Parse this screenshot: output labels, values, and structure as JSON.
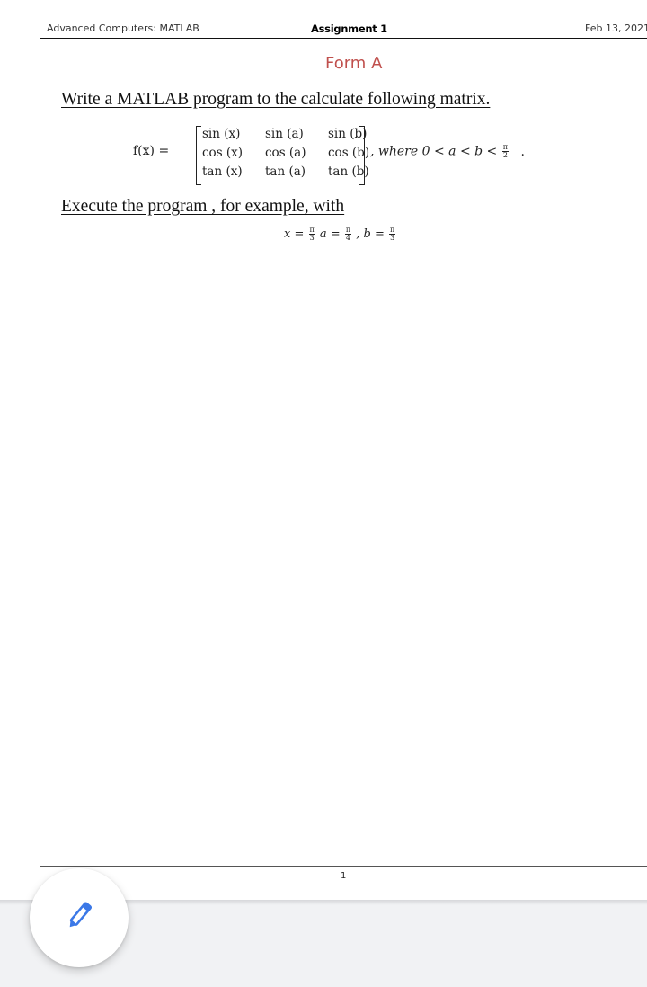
{
  "header": {
    "course": "Advanced Computers: MATLAB",
    "title": "Assignment 1",
    "date": "Feb 13, 2021"
  },
  "form_title": "Form A",
  "instructions": [
    "Write a MATLAB program to the calculate following matrix.",
    "Execute the program , for example, with"
  ],
  "equation": {
    "lhs": "f(x) =",
    "matrix": [
      [
        "sin (x)",
        "sin (a)",
        "sin (b)"
      ],
      [
        "cos (x)",
        "cos (a)",
        "cos (b)"
      ],
      [
        "tan (x)",
        "tan (a)",
        "tan (b)"
      ]
    ],
    "condition_prefix": ", where 0 < a < b <",
    "condition_frac_num": "π",
    "condition_frac_den": "2",
    "condition_suffix": "."
  },
  "example": {
    "x_label": "x =",
    "x_num": "π",
    "x_den": "3",
    "a_label": "a =",
    "a_num": "π",
    "a_den": "4",
    "b_label": ", b =",
    "b_num": "π",
    "b_den": "3"
  },
  "footer": {
    "page_number": "1"
  },
  "fab": {
    "icon": "pencil-icon",
    "color": "#3b78e7"
  }
}
